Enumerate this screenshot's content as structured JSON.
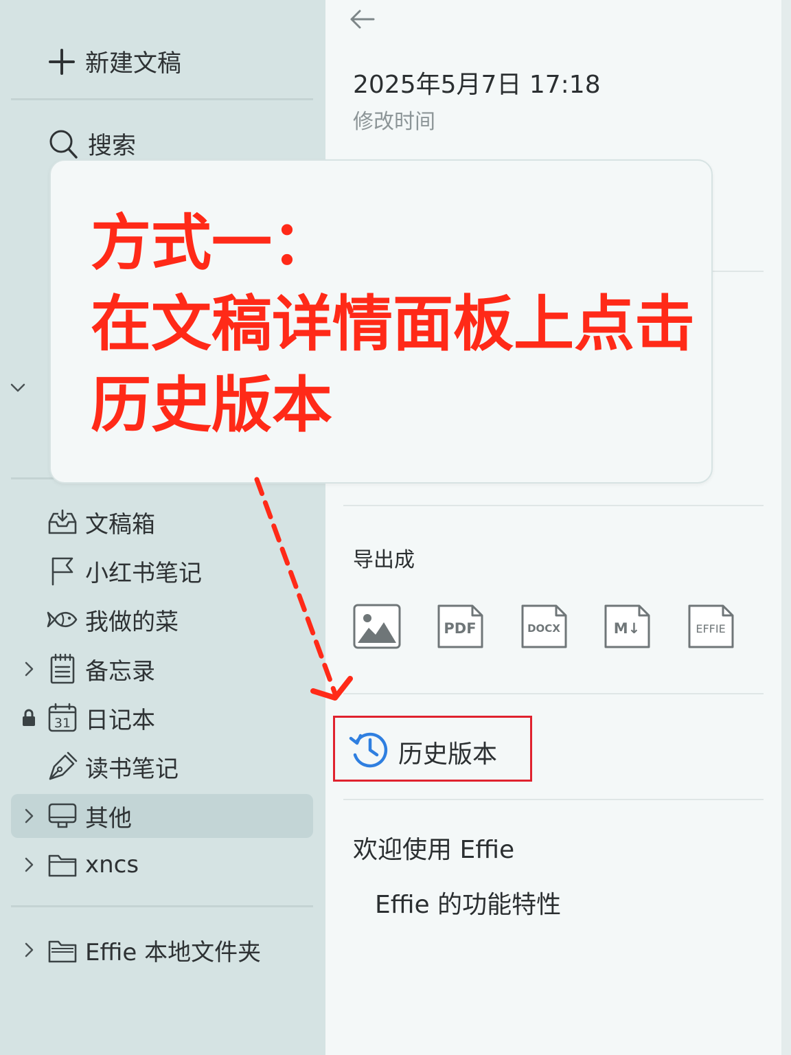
{
  "sidebar": {
    "new_doc": "新建文稿",
    "search": "搜索",
    "items": [
      {
        "label": "文稿箱",
        "icon": "inbox-icon"
      },
      {
        "label": "小红书笔记",
        "icon": "flag-icon"
      },
      {
        "label": "我做的菜",
        "icon": "fish-icon"
      },
      {
        "label": "备忘录",
        "icon": "notepad-icon"
      },
      {
        "label": "日记本",
        "icon": "calendar-icon",
        "calendar_day": "31"
      },
      {
        "label": "读书笔记",
        "icon": "pen-icon"
      },
      {
        "label": "其他",
        "icon": "monitor-icon"
      },
      {
        "label": "xncs",
        "icon": "folder-icon"
      },
      {
        "label": "Effie 本地文件夹",
        "icon": "folder-stack-icon"
      }
    ]
  },
  "detail": {
    "modified_date": "2025年5月7日 17:18",
    "modified_label": "修改时间",
    "export_label": "导出成",
    "export_formats": [
      "PDF",
      "DOCX",
      "M↓",
      "EFFIE"
    ],
    "history_label": "历史版本",
    "outline": [
      "欢迎使用 Effie",
      "Effie 的功能特性"
    ]
  },
  "callout": {
    "lines": [
      "方式一：",
      "在文稿详情面板上点击",
      "历史版本"
    ]
  },
  "colors": {
    "sidebar_bg": "#d5e3e3",
    "selected_bg": "#c3d5d6",
    "panel_bg": "#f4f8f8",
    "callout_text": "#ff2a18",
    "highlight_border": "#e0222e",
    "history_icon": "#2f7fe0"
  }
}
